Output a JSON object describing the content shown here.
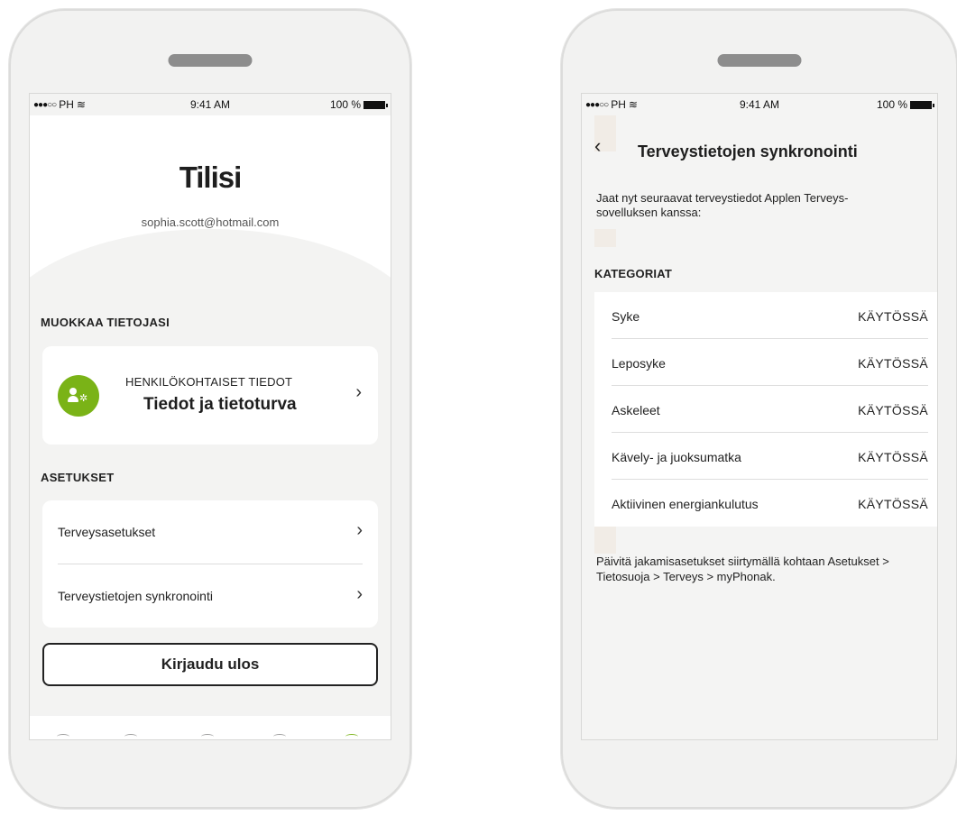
{
  "status": {
    "carrier": "PH",
    "time": "9:41 AM",
    "battery": "100 %"
  },
  "account": {
    "title": "Tilisi",
    "email": "sophia.scott@hotmail.com",
    "edit_section": "MUOKKAA TIETOJASI",
    "profile_card": {
      "subtitle": "HENKILÖKOHTAISET TIEDOT",
      "title": "Tiedot ja tietoturva",
      "icon": "user-gear-icon"
    },
    "settings_section": "ASETUKSET",
    "settings": [
      {
        "label": "Terveysasetukset"
      },
      {
        "label": "Terveystietojen synkronointi"
      }
    ],
    "logout_label": "Kirjaudu ulos"
  },
  "health_sync": {
    "title": "Terveystietojen synkronointi",
    "intro": "Jaat nyt seuraavat terveystiedot Applen Terveys-sovelluksen kanssa:",
    "categories_label": "KATEGORIAT",
    "categories": [
      {
        "name": "Syke",
        "status": "KÄYTÖSSÄ"
      },
      {
        "name": "Leposyke",
        "status": "KÄYTÖSSÄ"
      },
      {
        "name": "Askeleet",
        "status": "KÄYTÖSSÄ"
      },
      {
        "name": "Kävely- ja juoksumatka",
        "status": "KÄYTÖSSÄ"
      },
      {
        "name": "Aktiivinen energiankulutus",
        "status": "KÄYTÖSSÄ"
      }
    ],
    "footer": "Päivitä jakamisasetukset siirtymällä kohtaan Asetukset > Tietosuoja > Terveys > myPhonak."
  },
  "colors": {
    "accent": "#7ab317",
    "background": "#f3f3f2"
  }
}
